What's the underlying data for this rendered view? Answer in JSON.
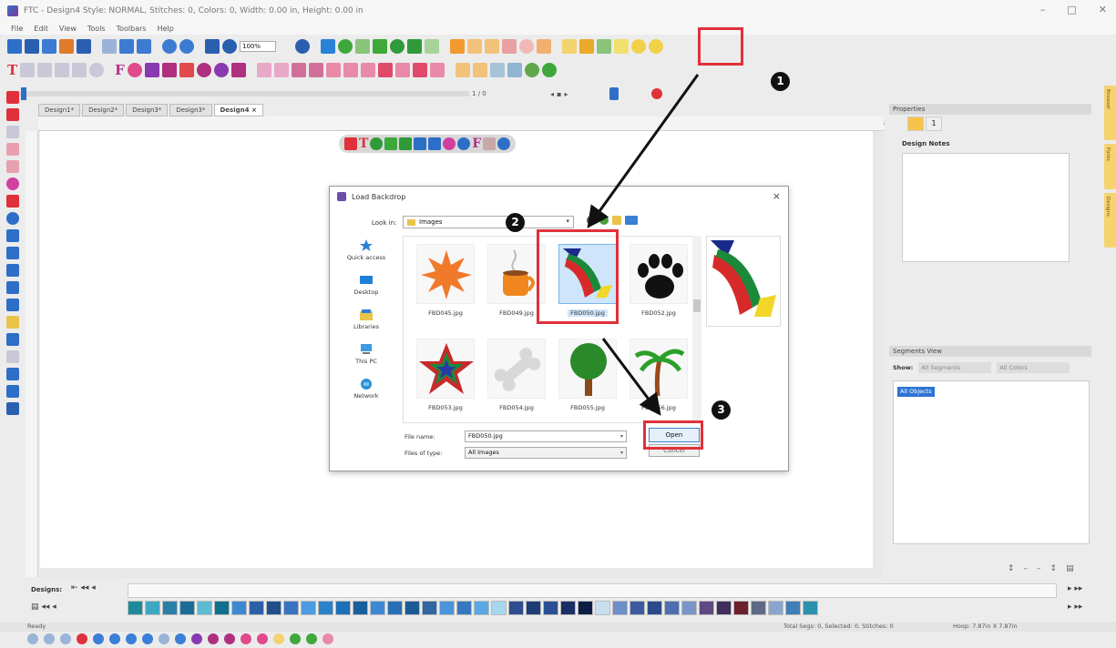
{
  "window": {
    "title": "FTC - Design4 Style: NORMAL, Stitches: 0, Colors: 0, Width: 0.00 in, Height: 0.00 in",
    "minimize": "–",
    "maximize": "□",
    "close": "✕"
  },
  "menu": [
    "File",
    "Edit",
    "View",
    "Tools",
    "Toolbars",
    "Help"
  ],
  "toolbar": {
    "zoom_value": "100%",
    "page_indicator": "1 / 0"
  },
  "tabs": [
    {
      "label": "Design1*"
    },
    {
      "label": "Design2*"
    },
    {
      "label": "Design3*"
    },
    {
      "label": "Design3*"
    },
    {
      "label": "Design4",
      "active": true
    }
  ],
  "tab_close": "×",
  "ruler_unit": "inches",
  "dialog": {
    "title": "Load Backdrop",
    "close": "×",
    "look_in_label": "Look in:",
    "look_in_value": "Images",
    "places": [
      {
        "label": "Quick access",
        "icon": "star-icon"
      },
      {
        "label": "Desktop",
        "icon": "desktop-icon"
      },
      {
        "label": "Libraries",
        "icon": "libraries-icon"
      },
      {
        "label": "This PC",
        "icon": "computer-icon"
      },
      {
        "label": "Network",
        "icon": "network-icon"
      }
    ],
    "files": [
      {
        "name": "FBD045.jpg",
        "icon": "burst-icon"
      },
      {
        "name": "FBD049.jpg",
        "icon": "mug-icon"
      },
      {
        "name": "FBD050.jpg",
        "icon": "rainbow-arrow-icon",
        "selected": true
      },
      {
        "name": "FBD052.jpg",
        "icon": "paw-icon"
      },
      {
        "name": "FBD053.jpg",
        "icon": "star-icon"
      },
      {
        "name": "FBD054.jpg",
        "icon": "bone-icon"
      },
      {
        "name": "FBD055.jpg",
        "icon": "tree-icon"
      },
      {
        "name": "FBD056.jpg",
        "icon": "palm-icon"
      }
    ],
    "file_name_label": "File name:",
    "file_name_value": "FBD050.jpg",
    "file_type_label": "Files of type:",
    "file_type_value": "All Images",
    "open_label": "Open",
    "cancel_label": "Cancel"
  },
  "annotations": {
    "badge1": "1",
    "badge2": "2",
    "badge3": "3",
    "highlight_color": "#e0313a"
  },
  "right_panel": {
    "properties_header": "Properties",
    "design_notes_label": "Design Notes",
    "prop_tab_2": "1",
    "segments_header": "Segments View",
    "show_label": "Show:",
    "filter1": "All Segments",
    "filter2": "All Colors",
    "segment_item": "All Objects"
  },
  "side_tabs": [
    "Browser",
    "Fonts",
    "Designs"
  ],
  "bottom": {
    "designs_label": "Designs:",
    "status_ready": "Ready",
    "status_total": "Total Segs: 0, Selected: 0, Stitches: 0",
    "status_hoop": "Hoop: 7.87in X 7.87in",
    "swatch_colors": [
      "#1f8a9a",
      "#3da7c4",
      "#2a7fa8",
      "#1c6d97",
      "#5bbbd2",
      "#0f6f8c",
      "#3b8ad1",
      "#2c5fa8",
      "#1e4f8a",
      "#3a73c2",
      "#4c9be0",
      "#2a83c9",
      "#1d6fb8",
      "#175f9e",
      "#3e89d6",
      "#2870b5",
      "#1a5b95",
      "#2f66a4",
      "#4a95d8",
      "#3678bf",
      "#5aa8e6",
      "#a6d7ee",
      "#2c4d8e",
      "#1e3d77",
      "#2a4f92",
      "#1a2f63",
      "#0e1d45",
      "#c7dff0",
      "#6d8fc7",
      "#3c5aa0",
      "#2b4a8a",
      "#4d6fb0",
      "#7a95c8",
      "#5c4a80",
      "#3e2f5c",
      "#6b1f2f",
      "#5d6a86",
      "#8aa6cc",
      "#3f7fb8",
      "#2a92b0"
    ]
  }
}
